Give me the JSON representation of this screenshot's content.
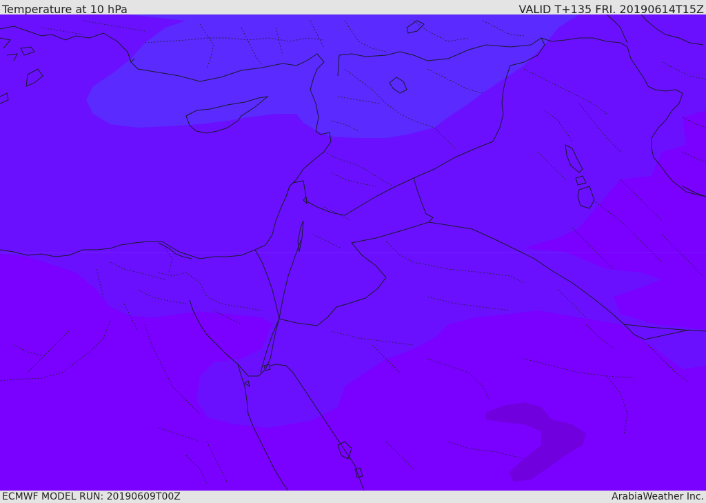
{
  "header": {
    "title": "Temperature at 10 hPa",
    "valid": "VALID T+135 FRI. 20190614T15Z"
  },
  "footer": {
    "model_run": "ECMWF MODEL RUN: 20190609T00Z",
    "credit": "ArabiaWeather Inc."
  },
  "map": {
    "parameter": "temperature",
    "level": "10 hPa",
    "bands": {
      "warmest": "#7a00ff",
      "mid": "#6a10ff",
      "cool": "#5a2aff",
      "darkest_patch": "#7000de"
    },
    "line_colors": {
      "coastline": "#1a1a2a",
      "border": "#2a2040"
    }
  }
}
